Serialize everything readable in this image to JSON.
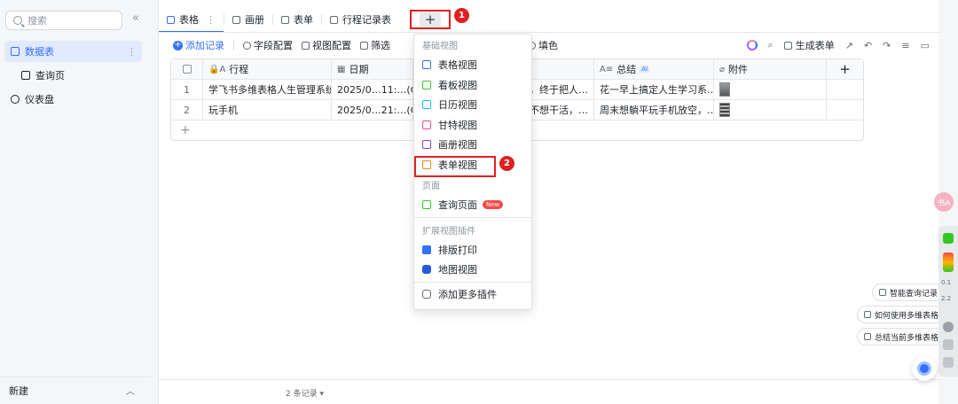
{
  "sidebar": {
    "search_placeholder": "搜索",
    "collapse_glyph": "«",
    "items": [
      {
        "label": "数据表",
        "icon": "table-icon",
        "active": true
      },
      {
        "label": "查询页",
        "icon": "query-page-icon"
      },
      {
        "label": "仪表盘",
        "icon": "dashboard-icon"
      }
    ],
    "footer_label": "新建"
  },
  "tabs": [
    {
      "label": "表格",
      "icon": "grid-icon",
      "active": true
    },
    {
      "label": "画册",
      "icon": "gallery-icon"
    },
    {
      "label": "表单",
      "icon": "form-icon"
    },
    {
      "label": "行程记录表",
      "icon": "form-icon"
    }
  ],
  "add_tab_glyph": "+",
  "toolbar": {
    "add_record": "添加记录",
    "field_config": "字段配置",
    "view_config": "视图配置",
    "filter": "筛选",
    "fill_color": "填色",
    "generate_form": "生成表单"
  },
  "table": {
    "headers": [
      "行程",
      "日期",
      "",
      "总结",
      "附件"
    ],
    "rows": [
      {
        "index": "1",
        "trip": "学飞书多维表格人生管理系统",
        "date": "2025/0…11:…(G…",
        "detail": "，终于把人…",
        "summary": "花一早上搞定人生学习系…"
      },
      {
        "index": "2",
        "trip": "玩手机",
        "date": "2025/0…21:…(G…",
        "detail": "不想干活，…",
        "summary": "周末想躺平玩手机放空，…"
      }
    ],
    "ai_badge": "AI",
    "add_glyph": "+"
  },
  "menu": {
    "section_basic": "基础视图",
    "basic_items": [
      {
        "label": "表格视图",
        "icon": "grid-view-icon"
      },
      {
        "label": "看板视图",
        "icon": "kanban-view-icon"
      },
      {
        "label": "日历视图",
        "icon": "calendar-view-icon"
      },
      {
        "label": "甘特视图",
        "icon": "gantt-view-icon"
      },
      {
        "label": "画册视图",
        "icon": "gallery-view-icon"
      },
      {
        "label": "表单视图",
        "icon": "form-view-icon"
      }
    ],
    "section_page": "页面",
    "page_items": [
      {
        "label": "查询页面",
        "badge": "New",
        "icon": "query-page-icon"
      }
    ],
    "section_plugins": "扩展视图插件",
    "plugin_items": [
      {
        "label": "排版打印",
        "icon": "print-icon"
      },
      {
        "label": "地图视图",
        "icon": "map-view-icon"
      }
    ],
    "more_plugins": "添加更多插件"
  },
  "callouts": [
    "1",
    "2"
  ],
  "footer": {
    "records": "2 条记录"
  },
  "floating": {
    "smart_query": "智能查询记录",
    "how_to_use": "如何使用多维表格",
    "summarize": "总结当前多维表格",
    "avatar_text": "书A"
  },
  "right_strip": {
    "stat1": "0.1",
    "stat2": "2.2"
  },
  "colors": {
    "accent": "#3370ff",
    "callout": "#e02020"
  }
}
